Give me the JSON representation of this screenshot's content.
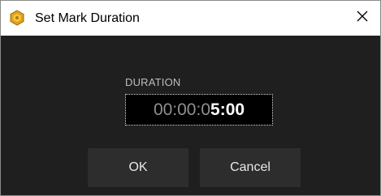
{
  "window": {
    "title": "Set Mark Duration",
    "app_icon": "gold-hexagon-icon",
    "close_glyph": "✕"
  },
  "duration": {
    "label": "DURATION",
    "value_dim": "00:00:0",
    "value_bright": "5:00"
  },
  "buttons": {
    "ok_label": "OK",
    "cancel_label": "Cancel"
  },
  "colors": {
    "dialog_background": "#1f1f1f",
    "titlebar_background": "#ffffff",
    "button_background": "#2d2d2d",
    "field_background": "#000000",
    "icon_gold": "#e0a31a"
  }
}
